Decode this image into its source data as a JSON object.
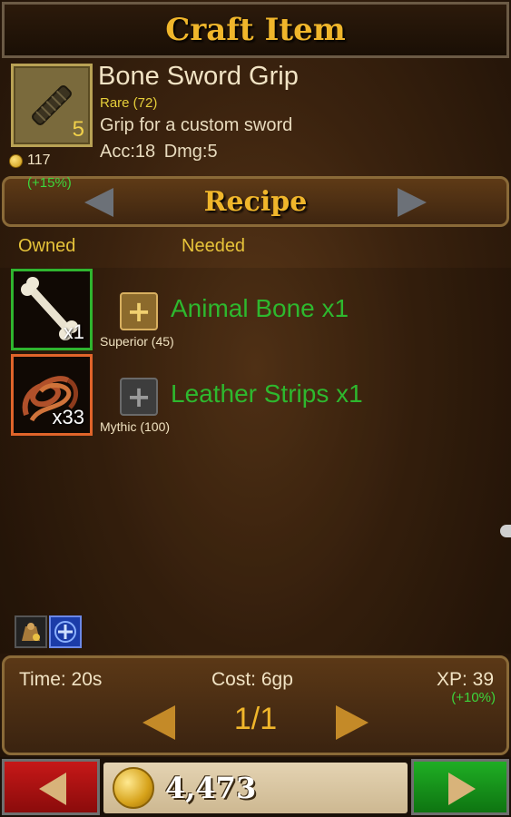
{
  "header": {
    "title": "Craft Item"
  },
  "item": {
    "name": "Bone Sword Grip",
    "rarity": "Rare (72)",
    "description": "Grip for a custom sword",
    "stats": "Acc:18 Dmg:5",
    "level": "5",
    "price": "117",
    "price_bonus": "(+15%)",
    "icon": "sword-grip-icon"
  },
  "recipe": {
    "label": "Recipe"
  },
  "columns": {
    "owned": "Owned",
    "needed": "Needed"
  },
  "ingredients": [
    {
      "name": "Animal Bone x1",
      "owned": "x1",
      "tier": "Superior (45)",
      "icon": "bone-icon",
      "border": "#2fb52f",
      "plus_bg": "#8c6a2c",
      "plus_color": "#f0d070"
    },
    {
      "name": "Leather Strips x1",
      "owned": "x33",
      "tier": "Mythic (100)",
      "icon": "leather-strips-icon",
      "border": "#e0642a",
      "plus_bg": "#3d3d3d",
      "plus_color": "#9a9a9a"
    }
  ],
  "footer_panel": {
    "time": "Time: 20s",
    "cost": "Cost: 6gp",
    "xp": "XP: 39",
    "xp_bonus": "(+10%)",
    "page": "1/1"
  },
  "gold": "4,473",
  "colors": {
    "accent": "#f0b62b",
    "green": "#2eb82e",
    "back": "#c71818",
    "next": "#1fae24"
  }
}
